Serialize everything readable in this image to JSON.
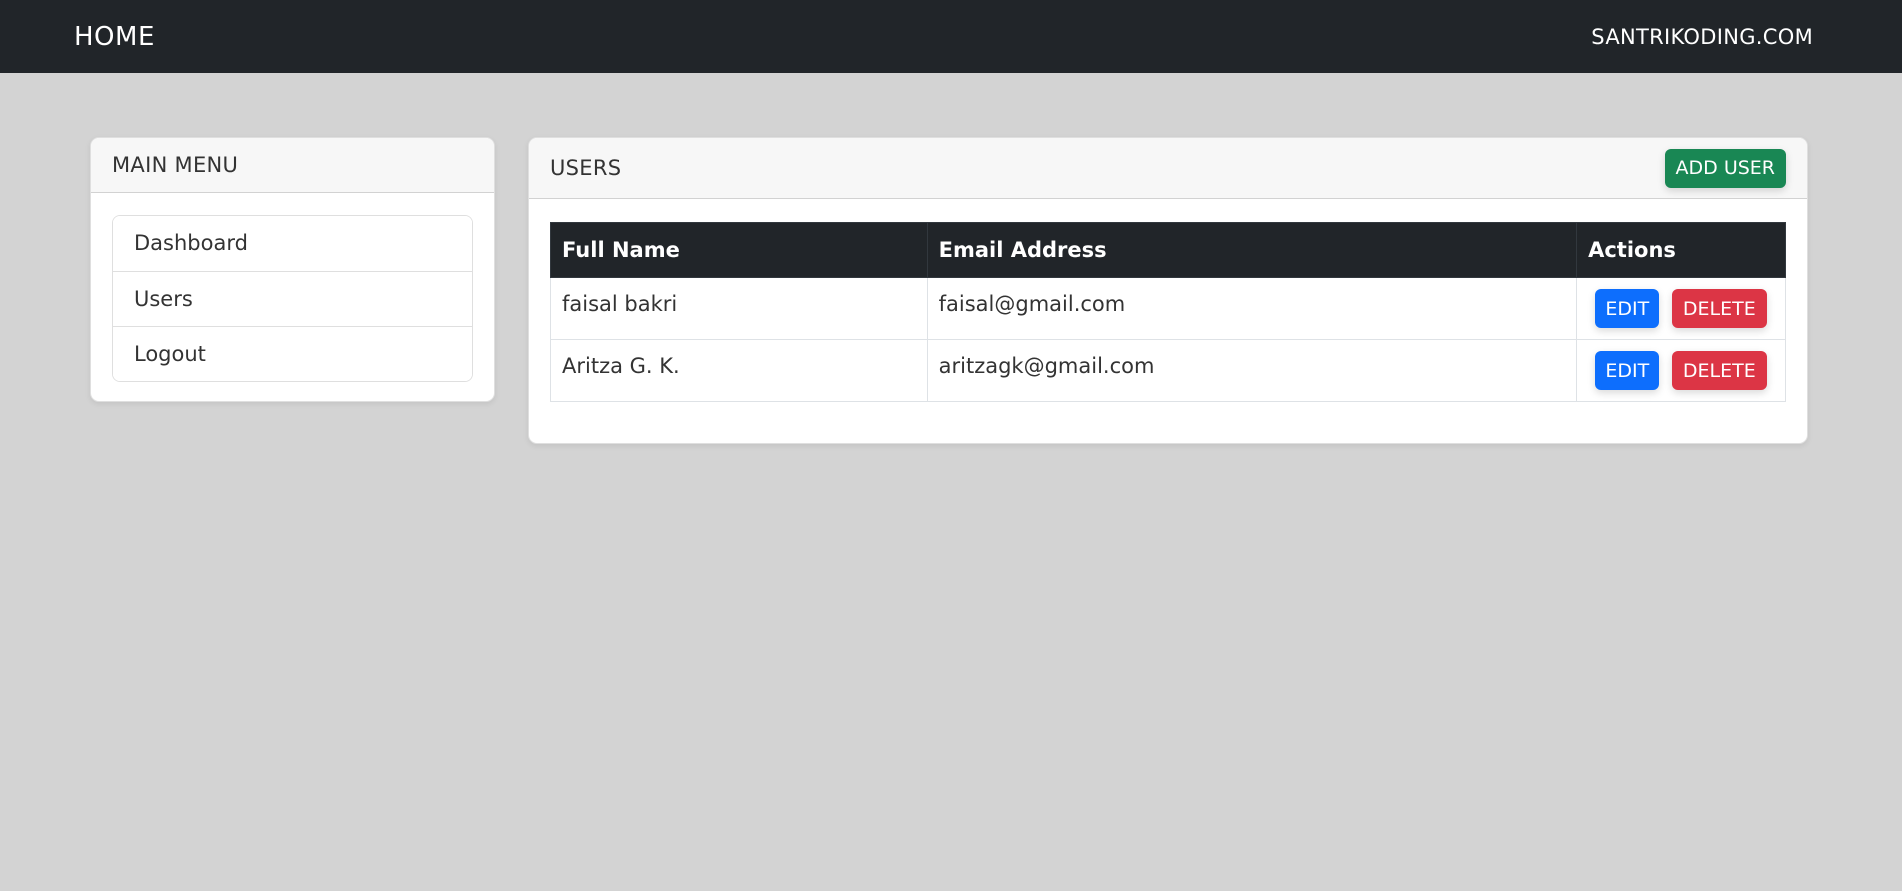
{
  "navbar": {
    "brand": "HOME",
    "right_link": "SANTRIKODING.COM",
    "background": "#212529"
  },
  "sidebar": {
    "title": "MAIN MENU",
    "items": [
      {
        "label": "Dashboard"
      },
      {
        "label": "Users"
      },
      {
        "label": "Logout"
      }
    ]
  },
  "users": {
    "title": "USERS",
    "add_button": "ADD USER",
    "columns": [
      "Full Name",
      "Email Address",
      "Actions"
    ],
    "rows": [
      {
        "name": "faisal bakri",
        "email": "faisal@gmail.com",
        "edit": "EDIT",
        "delete": "DELETE"
      },
      {
        "name": "Aritza G. K.",
        "email": "aritzagk@gmail.com",
        "edit": "EDIT",
        "delete": "DELETE"
      }
    ]
  },
  "colors": {
    "page_background": "#d3d3d3",
    "success": "#198754",
    "primary": "#0d6efd",
    "danger": "#dc3545"
  }
}
